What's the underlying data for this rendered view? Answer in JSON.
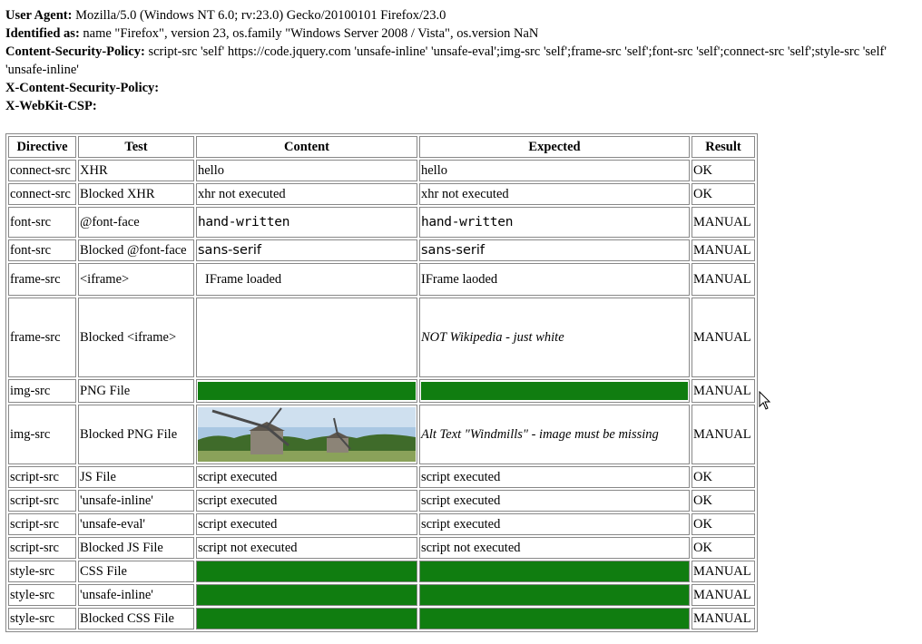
{
  "info": [
    {
      "label": "User Agent:",
      "value": "Mozilla/5.0 (Windows NT 6.0; rv:23.0) Gecko/20100101 Firefox/23.0"
    },
    {
      "label": "Identified as:",
      "value": "name \"Firefox\", version 23, os.family \"Windows Server 2008 / Vista\", os.version NaN"
    },
    {
      "label": "Content-Security-Policy:",
      "value": "script-src 'self' https://code.jquery.com 'unsafe-inline' 'unsafe-eval';img-src 'self';frame-src 'self';font-src 'self';connect-src 'self';style-src 'self' 'unsafe-inline'"
    },
    {
      "label": "X-Content-Security-Policy:",
      "value": ""
    },
    {
      "label": "X-WebKit-CSP:",
      "value": ""
    }
  ],
  "table": {
    "headers": [
      "Directive",
      "Test",
      "Content",
      "Expected",
      "Result"
    ],
    "rows": [
      {
        "directive": "connect-src",
        "test": "XHR",
        "content": "hello",
        "expected": "hello",
        "result": "OK"
      },
      {
        "directive": "connect-src",
        "test": "Blocked XHR",
        "content": "xhr not executed",
        "expected": "xhr not executed",
        "result": "OK"
      },
      {
        "directive": "font-src",
        "test": "@font-face",
        "content": "hand-written",
        "expected": "hand-written",
        "result": "MANUAL"
      },
      {
        "directive": "font-src",
        "test": "Blocked @font-face",
        "content": "sans-serif",
        "expected": "sans-serif",
        "result": "MANUAL"
      },
      {
        "directive": "frame-src",
        "test": "<iframe>",
        "content": "IFrame loaded",
        "expected": "IFrame laoded",
        "result": "MANUAL"
      },
      {
        "directive": "frame-src",
        "test": "Blocked <iframe>",
        "content": "",
        "expected": "NOT Wikipedia - just white",
        "result": "MANUAL"
      },
      {
        "directive": "img-src",
        "test": "PNG File",
        "content": "",
        "expected": "",
        "result": "MANUAL"
      },
      {
        "directive": "img-src",
        "test": "Blocked PNG File",
        "content": "",
        "expected": "Alt Text \"Windmills\" - image must be missing",
        "result": "MANUAL"
      },
      {
        "directive": "script-src",
        "test": "JS File",
        "content": "script executed",
        "expected": "script executed",
        "result": "OK"
      },
      {
        "directive": "script-src",
        "test": "'unsafe-inline'",
        "content": "script executed",
        "expected": "script executed",
        "result": "OK"
      },
      {
        "directive": "script-src",
        "test": "'unsafe-eval'",
        "content": "script executed",
        "expected": "script executed",
        "result": "OK"
      },
      {
        "directive": "script-src",
        "test": "Blocked JS File",
        "content": "script not executed",
        "expected": "script not executed",
        "result": "OK"
      },
      {
        "directive": "style-src",
        "test": "CSS File",
        "content": "",
        "expected": "",
        "result": "MANUAL"
      },
      {
        "directive": "style-src",
        "test": "'unsafe-inline'",
        "content": "",
        "expected": "",
        "result": "MANUAL"
      },
      {
        "directive": "style-src",
        "test": "Blocked CSS File",
        "content": "",
        "expected": "",
        "result": "MANUAL"
      }
    ]
  },
  "colors": {
    "pass_green": "#107d10",
    "border": "#888888"
  },
  "icons": {
    "cursor": "mouse-pointer-icon",
    "image": "windmills-image"
  }
}
